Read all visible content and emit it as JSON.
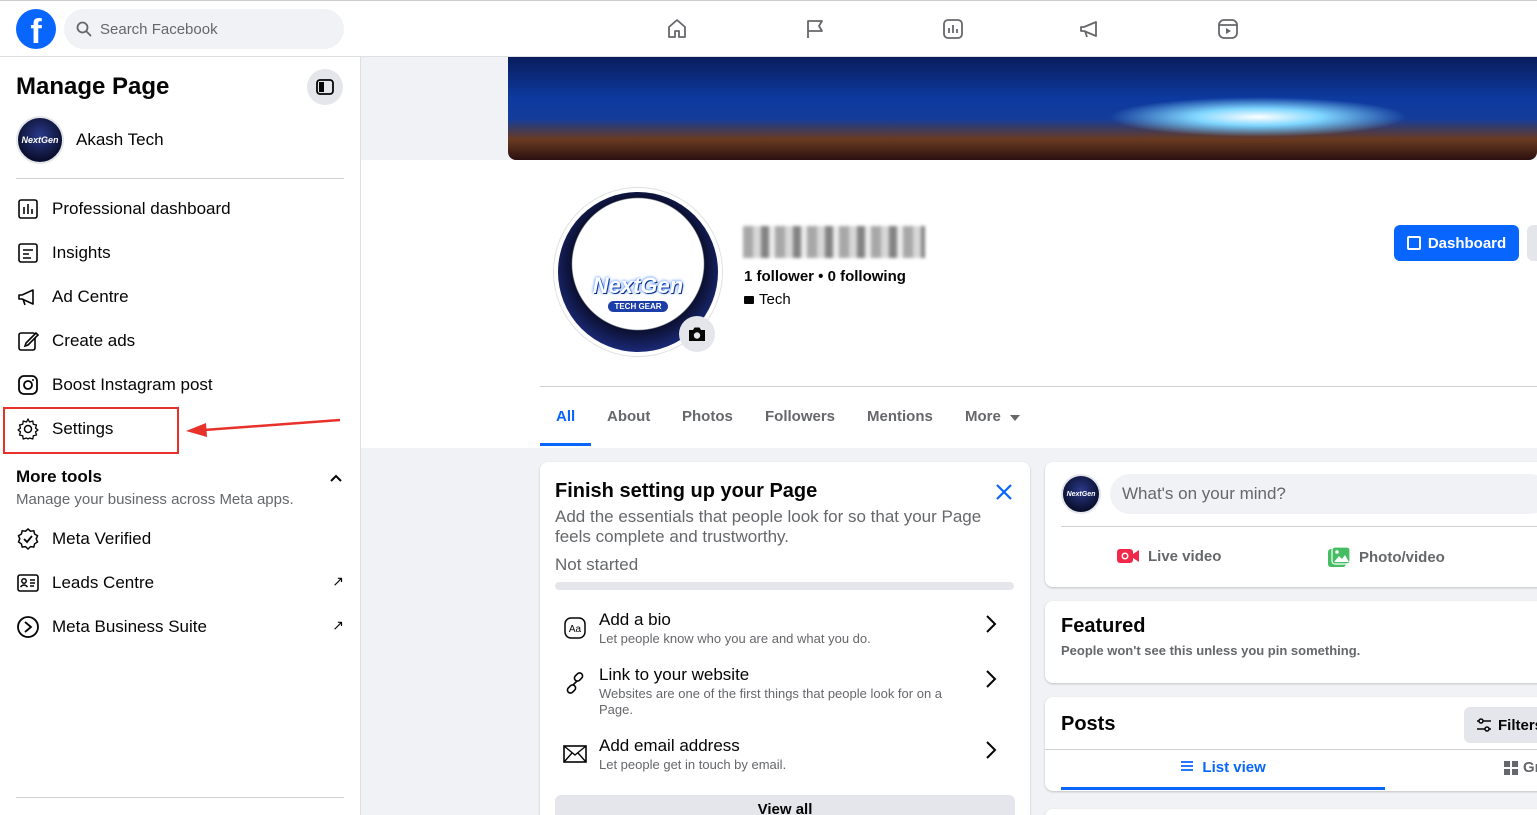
{
  "topbar": {
    "logo": "f",
    "search_placeholder": "Search Facebook",
    "nav_icons": [
      "home-icon",
      "flag-icon",
      "insights-icon",
      "megaphone-icon",
      "reels-icon"
    ]
  },
  "sidebar": {
    "title": "Manage Page",
    "page_name": "Akash Tech",
    "items": [
      {
        "label": "Professional dashboard",
        "icon": "dashboard-icon"
      },
      {
        "label": "Insights",
        "icon": "insights-icon"
      },
      {
        "label": "Ad Centre",
        "icon": "megaphone-icon"
      },
      {
        "label": "Create ads",
        "icon": "pencil-icon"
      },
      {
        "label": "Boost Instagram post",
        "icon": "instagram-icon"
      },
      {
        "label": "Settings",
        "icon": "gear-icon"
      }
    ],
    "more_tools": {
      "title": "More tools",
      "subtitle": "Manage your business across Meta apps.",
      "items": [
        {
          "label": "Meta Verified",
          "icon": "verified-badge-icon",
          "external": ""
        },
        {
          "label": "Leads Centre",
          "icon": "contact-card-icon",
          "external": "↗"
        },
        {
          "label": "Meta Business Suite",
          "icon": "business-suite-icon",
          "external": "↗"
        }
      ]
    }
  },
  "profile": {
    "logo_text": "NextGen",
    "logo_sub": "TECH GEAR",
    "followers_text": "1 follower • 0 following",
    "category": "Tech",
    "dashboard_button": "Dashboard"
  },
  "tabs": [
    "All",
    "About",
    "Photos",
    "Followers",
    "Mentions",
    "More"
  ],
  "setup": {
    "title": "Finish setting up your Page",
    "description": "Add the essentials that people look for so that your Page feels complete and trustworthy.",
    "status": "Not started",
    "progress": 0,
    "tasks": [
      {
        "title": "Add a bio",
        "desc": "Let people know who you are and what you do.",
        "icon": "text-aa-icon"
      },
      {
        "title": "Link to your website",
        "desc": "Websites are one of the first things that people look for on a Page.",
        "icon": "link-icon"
      },
      {
        "title": "Add email address",
        "desc": "Let people get in touch by email.",
        "icon": "envelope-icon"
      }
    ],
    "view_all": "View all"
  },
  "composer": {
    "placeholder": "What's on your mind?",
    "live_video": "Live video",
    "photo_video": "Photo/video"
  },
  "featured": {
    "title": "Featured",
    "subtitle": "People won't see this unless you pin something."
  },
  "posts": {
    "title": "Posts",
    "filters": "Filters",
    "list_view": "List view",
    "grid_view": "Gr"
  },
  "colors": {
    "accent": "#0866ff",
    "highlight": "#e8312a"
  }
}
